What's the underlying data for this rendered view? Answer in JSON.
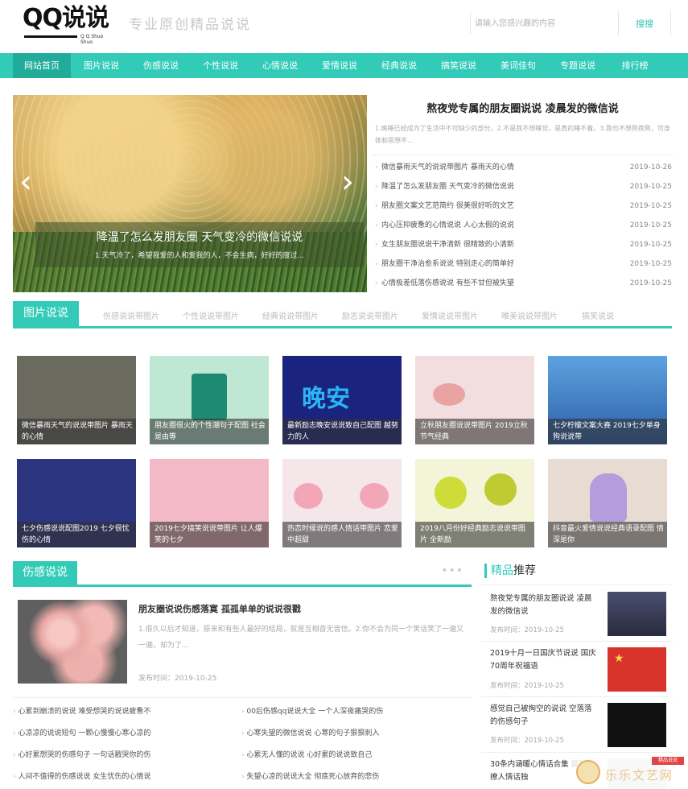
{
  "header": {
    "logo_text": "QQ说说",
    "logo_sub": "Q Q Shuo Shuo",
    "slogan": "专业原创精品说说",
    "search_placeholder": "请输入您感兴趣的内容",
    "search_button": "搜搜"
  },
  "nav": [
    "网站首页",
    "图片说说",
    "伤感说说",
    "个性说说",
    "心情说说",
    "爱情说说",
    "经典说说",
    "搞笑说说",
    "美词佳句",
    "专题说说",
    "排行榜"
  ],
  "slider": {
    "title": "降温了怎么发朋友圈 天气变冷的微信说说",
    "desc": "1.天气冷了，希望我爱的人和爱我的人，不会生病，好好的度过..."
  },
  "feature": {
    "title": "熬夜党专属的朋友圈说说 凌晨发的微信说",
    "desc": "1.晚睡已经成为了生活中不可缺少的部分。2.不是我不想睡觉，是真的睡不着。3.我也不想熬夜熬，可身体和思想不..."
  },
  "news": [
    {
      "title": "微信暴雨天气的说说带图片 暴雨天的心情",
      "date": "2019-10-26"
    },
    {
      "title": "降温了怎么发朋友圈 天气变冷的微信说说",
      "date": "2019-10-25"
    },
    {
      "title": "朋友圈文案文艺范简约 很美很好听的文艺",
      "date": "2019-10-25"
    },
    {
      "title": "内心压抑疲惫的心情说说 人心太假的说说",
      "date": "2019-10-25"
    },
    {
      "title": "女生朋友圈说说干净清新 很精致的小清新",
      "date": "2019-10-25"
    },
    {
      "title": "朋友圈干净治愈系说说 特别走心的简单好",
      "date": "2019-10-25"
    },
    {
      "title": "心情极差低落伤感说说 有些不甘但被失望",
      "date": "2019-10-25"
    }
  ],
  "pic_section": {
    "label": "图片说说",
    "tabs": [
      "伤感说说带图片",
      "个性说说带图片",
      "经典说说带图片",
      "励志说说带图片",
      "爱情说说带图片",
      "唯美说说带图片",
      "搞笑说说"
    ]
  },
  "cards": [
    {
      "caption": "微信暴雨天气的说说带图片 暴雨天的心情",
      "color": "#6b6a5f"
    },
    {
      "caption": "朋友圈很火的个性潮句子配图 社会是由等",
      "color": "#bfe8d4"
    },
    {
      "caption": "最新励志晚安说说致自己配图 越努力的人",
      "color": "#1a237e"
    },
    {
      "caption": "立秋朋友圈说说带图片 2019立秋节气经典",
      "color": "#f2dede"
    },
    {
      "caption": "七夕柠檬文案大赛 2019七夕单身狗说说带",
      "color": "#2c5fa8"
    },
    {
      "caption": "七夕伤感说说配图2019 七夕很忧伤的心情",
      "color": "#2c3580"
    },
    {
      "caption": "2019七夕搞笑说说带图片 让人爆笑的七夕",
      "color": "#f4b9c6"
    },
    {
      "caption": "热恋时候说的感人情话带图片 恋爱中超甜",
      "color": "#f5e6ea"
    },
    {
      "caption": "2019八月份好经典励志说说带图片 全新励",
      "color": "#f3f4d8"
    },
    {
      "caption": "抖音最火爱情说说经典语录配图 情深是你",
      "color": "#e8dcd2"
    }
  ],
  "sad_section": {
    "label": "伤感说说",
    "dots": "•••",
    "article_title": "朋友圈说说伤感落寞 孤孤单单的说说很戳",
    "article_desc": "1.很久以后才知道，原来和有些人最好的结局，就是互相杳无音信。2.你不会为同一个笑话笑了一遍又一遍，却为了...",
    "article_time": "发布时间：2019-10-25",
    "links_left": [
      "心累到崩溃的说说 难受想哭的说说疲惫不",
      "心凉凉的说说短句 一颗心慢慢心寒心凉的",
      "心好累想哭的伤感句子 一句话戳哭你的伤",
      "人间不值得的伤感说说 女生忧伤的心情说"
    ],
    "links_right": [
      "00后伤感qq说说大全 一个人深夜痛哭的伤",
      "心寒失望的微信说说 心寒的句子狠狠刺入",
      "心累无人懂的说说 心好累的说说致自己",
      "失望心凉的说说大全 彻底死心放弃的悲伤"
    ]
  },
  "recommend": {
    "label_hl": "精品",
    "label": "推荐",
    "items": [
      {
        "title": "熬夜党专属的朋友圈说说 凌晨发的微信说",
        "time": "发布时间：2019-10-25",
        "color": "#3a3d55"
      },
      {
        "title": "2019十月一日国庆节说说 国庆70周年祝福语",
        "time": "发布时间：2019-10-25",
        "color": "#d8342c"
      },
      {
        "title": "感觉自己被掏空的说说 空落落的伤感句子",
        "time": "发布时间：2019-10-25",
        "color": "#111111"
      },
      {
        "title": "30条内涵暖心情话合集 最甜的撩人情话独",
        "time": "",
        "color": "#cfcfcf"
      }
    ]
  },
  "watermark": {
    "badge": "精品说说",
    "text": "乐乐文艺网"
  }
}
